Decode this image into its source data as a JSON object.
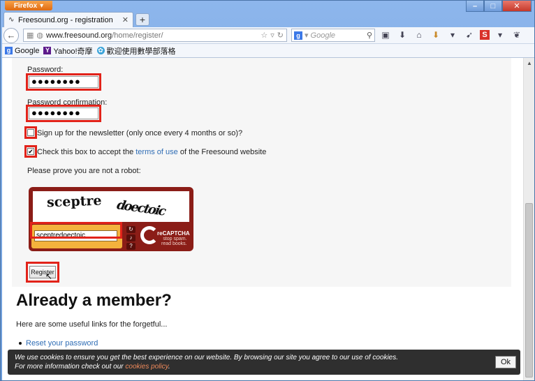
{
  "browser": {
    "app_button": "Firefox",
    "tab_title": "Freesound.org - registration",
    "url_host": "www.freesound.org",
    "url_path": "/home/register/",
    "search_placeholder": "Google",
    "bookmarks": [
      "Google",
      "Yahoo!奇摩",
      "歡迎使用數學部落格"
    ]
  },
  "form": {
    "password_label": "Password:",
    "password_value": "●●●●●●●●",
    "password_confirm_label": "Password confirmation:",
    "password_confirm_value": "●●●●●●●●",
    "newsletter_text": "Sign up for the newsletter (only once every 4 months or so)?",
    "newsletter_checked": false,
    "terms_prefix": "Check this box to accept the ",
    "terms_link": "terms of use",
    "terms_suffix": " of the Freesound website",
    "terms_checked": true,
    "robot_label": "Please prove you are not a robot:",
    "captcha_word1": "sceptre",
    "captcha_word2": "doectoic",
    "captcha_input": "sceptredoectoic",
    "recaptcha_name": "reCAPTCHA",
    "recaptcha_tag1": "stop spam.",
    "recaptcha_tag2": "read books.",
    "register_label": "Register"
  },
  "member": {
    "title": "Already a member?",
    "subtitle": "Here are some useful links for the forgetful...",
    "reset_link": "Reset your password"
  },
  "cookie": {
    "line1": "We use cookies to ensure you get the best experience on our website. By browsing our site you agree to our use of cookies.",
    "line2_prefix": "For more information check out our ",
    "line2_link": "cookies policy",
    "line2_suffix": ".",
    "ok_label": "Ok"
  },
  "colors": {
    "highlight": "#e2231a",
    "captcha_bg": "#8b1d17",
    "link": "#2f6db5"
  }
}
